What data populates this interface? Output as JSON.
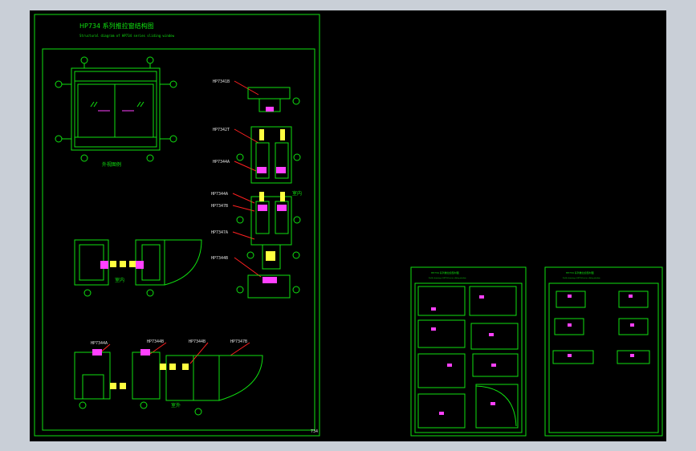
{
  "drawing": {
    "title": "HP734 系列推拉窗结构图",
    "subtitle": "Structural diagram of HP734 series sliding window",
    "elevation_caption": "外视图例",
    "section_caption_1": "室内",
    "section_caption_2": "室内",
    "section_caption_3": "室外",
    "page_number": "734",
    "part_labels": [
      "HP7341B",
      "HP7342T",
      "HP7344A",
      "HP7344A",
      "HP7347B",
      "HP7347A",
      "HP7344B"
    ],
    "bottom_labels": [
      "HP7344A",
      "HP7344B",
      "HP7344B",
      "HP7347B"
    ]
  },
  "sheets": {
    "sheet2_title": "HP734 系列推拉窗型材图",
    "sheet2_subtitle": "Profile drawing of HP734 series sliding window",
    "sheet3_title": "HP734 系列推拉窗型材图",
    "sheet3_subtitle": "Profile drawing of HP734 series sliding window"
  },
  "colors": {
    "background": "#000000",
    "frame": "#10e010",
    "annotation": "#ff2020",
    "accent": "#ff40ff",
    "highlight": "#ffff40"
  }
}
